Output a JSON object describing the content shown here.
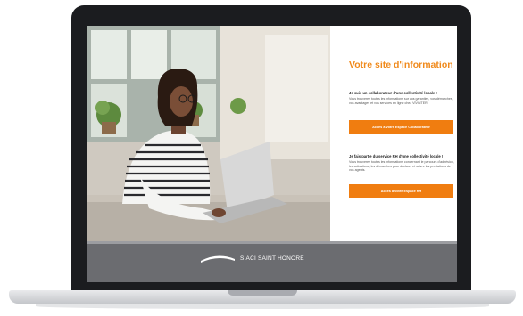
{
  "brand": {
    "name": "SIACI SAINT HONORE"
  },
  "panel": {
    "title": "Votre site d'information",
    "agent": {
      "heading": "Je suis un collaborateur d'une collectivité locale !",
      "body": "Vous trouverez toutes les informations sur vos garanties, vos démarches, vos avantages et vos services en ligne chez VIVINTER",
      "button": "Accès à votre Espace Collaborateur"
    },
    "hr": {
      "heading": "Je fais partie du service RH d'une collectivité locale !",
      "body": "Vous trouverez toutes les informations concernant le parcours d'adhésion, les cotisations, les démarches pour déclarer et suivre les prestations de vos agents.",
      "button": "Accès à votre Espace RH"
    }
  },
  "colors": {
    "accent": "#f07d10",
    "title": "#f08a1c",
    "footer": "#6b6c70"
  }
}
